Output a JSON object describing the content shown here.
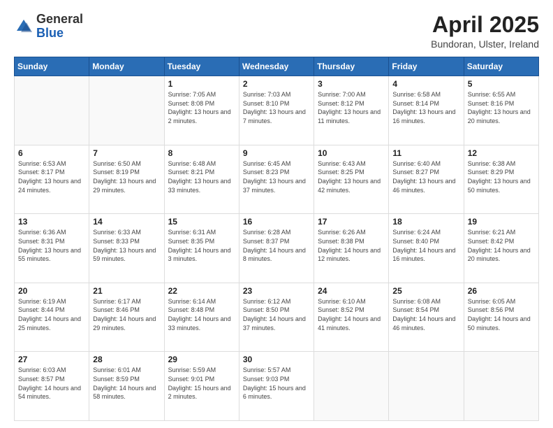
{
  "header": {
    "logo_general": "General",
    "logo_blue": "Blue",
    "month_title": "April 2025",
    "location": "Bundoran, Ulster, Ireland"
  },
  "days_of_week": [
    "Sunday",
    "Monday",
    "Tuesday",
    "Wednesday",
    "Thursday",
    "Friday",
    "Saturday"
  ],
  "weeks": [
    [
      {
        "day": "",
        "info": ""
      },
      {
        "day": "",
        "info": ""
      },
      {
        "day": "1",
        "info": "Sunrise: 7:05 AM\nSunset: 8:08 PM\nDaylight: 13 hours\nand 2 minutes."
      },
      {
        "day": "2",
        "info": "Sunrise: 7:03 AM\nSunset: 8:10 PM\nDaylight: 13 hours\nand 7 minutes."
      },
      {
        "day": "3",
        "info": "Sunrise: 7:00 AM\nSunset: 8:12 PM\nDaylight: 13 hours\nand 11 minutes."
      },
      {
        "day": "4",
        "info": "Sunrise: 6:58 AM\nSunset: 8:14 PM\nDaylight: 13 hours\nand 16 minutes."
      },
      {
        "day": "5",
        "info": "Sunrise: 6:55 AM\nSunset: 8:16 PM\nDaylight: 13 hours\nand 20 minutes."
      }
    ],
    [
      {
        "day": "6",
        "info": "Sunrise: 6:53 AM\nSunset: 8:17 PM\nDaylight: 13 hours\nand 24 minutes."
      },
      {
        "day": "7",
        "info": "Sunrise: 6:50 AM\nSunset: 8:19 PM\nDaylight: 13 hours\nand 29 minutes."
      },
      {
        "day": "8",
        "info": "Sunrise: 6:48 AM\nSunset: 8:21 PM\nDaylight: 13 hours\nand 33 minutes."
      },
      {
        "day": "9",
        "info": "Sunrise: 6:45 AM\nSunset: 8:23 PM\nDaylight: 13 hours\nand 37 minutes."
      },
      {
        "day": "10",
        "info": "Sunrise: 6:43 AM\nSunset: 8:25 PM\nDaylight: 13 hours\nand 42 minutes."
      },
      {
        "day": "11",
        "info": "Sunrise: 6:40 AM\nSunset: 8:27 PM\nDaylight: 13 hours\nand 46 minutes."
      },
      {
        "day": "12",
        "info": "Sunrise: 6:38 AM\nSunset: 8:29 PM\nDaylight: 13 hours\nand 50 minutes."
      }
    ],
    [
      {
        "day": "13",
        "info": "Sunrise: 6:36 AM\nSunset: 8:31 PM\nDaylight: 13 hours\nand 55 minutes."
      },
      {
        "day": "14",
        "info": "Sunrise: 6:33 AM\nSunset: 8:33 PM\nDaylight: 13 hours\nand 59 minutes."
      },
      {
        "day": "15",
        "info": "Sunrise: 6:31 AM\nSunset: 8:35 PM\nDaylight: 14 hours\nand 3 minutes."
      },
      {
        "day": "16",
        "info": "Sunrise: 6:28 AM\nSunset: 8:37 PM\nDaylight: 14 hours\nand 8 minutes."
      },
      {
        "day": "17",
        "info": "Sunrise: 6:26 AM\nSunset: 8:38 PM\nDaylight: 14 hours\nand 12 minutes."
      },
      {
        "day": "18",
        "info": "Sunrise: 6:24 AM\nSunset: 8:40 PM\nDaylight: 14 hours\nand 16 minutes."
      },
      {
        "day": "19",
        "info": "Sunrise: 6:21 AM\nSunset: 8:42 PM\nDaylight: 14 hours\nand 20 minutes."
      }
    ],
    [
      {
        "day": "20",
        "info": "Sunrise: 6:19 AM\nSunset: 8:44 PM\nDaylight: 14 hours\nand 25 minutes."
      },
      {
        "day": "21",
        "info": "Sunrise: 6:17 AM\nSunset: 8:46 PM\nDaylight: 14 hours\nand 29 minutes."
      },
      {
        "day": "22",
        "info": "Sunrise: 6:14 AM\nSunset: 8:48 PM\nDaylight: 14 hours\nand 33 minutes."
      },
      {
        "day": "23",
        "info": "Sunrise: 6:12 AM\nSunset: 8:50 PM\nDaylight: 14 hours\nand 37 minutes."
      },
      {
        "day": "24",
        "info": "Sunrise: 6:10 AM\nSunset: 8:52 PM\nDaylight: 14 hours\nand 41 minutes."
      },
      {
        "day": "25",
        "info": "Sunrise: 6:08 AM\nSunset: 8:54 PM\nDaylight: 14 hours\nand 46 minutes."
      },
      {
        "day": "26",
        "info": "Sunrise: 6:05 AM\nSunset: 8:56 PM\nDaylight: 14 hours\nand 50 minutes."
      }
    ],
    [
      {
        "day": "27",
        "info": "Sunrise: 6:03 AM\nSunset: 8:57 PM\nDaylight: 14 hours\nand 54 minutes."
      },
      {
        "day": "28",
        "info": "Sunrise: 6:01 AM\nSunset: 8:59 PM\nDaylight: 14 hours\nand 58 minutes."
      },
      {
        "day": "29",
        "info": "Sunrise: 5:59 AM\nSunset: 9:01 PM\nDaylight: 15 hours\nand 2 minutes."
      },
      {
        "day": "30",
        "info": "Sunrise: 5:57 AM\nSunset: 9:03 PM\nDaylight: 15 hours\nand 6 minutes."
      },
      {
        "day": "",
        "info": ""
      },
      {
        "day": "",
        "info": ""
      },
      {
        "day": "",
        "info": ""
      }
    ]
  ]
}
